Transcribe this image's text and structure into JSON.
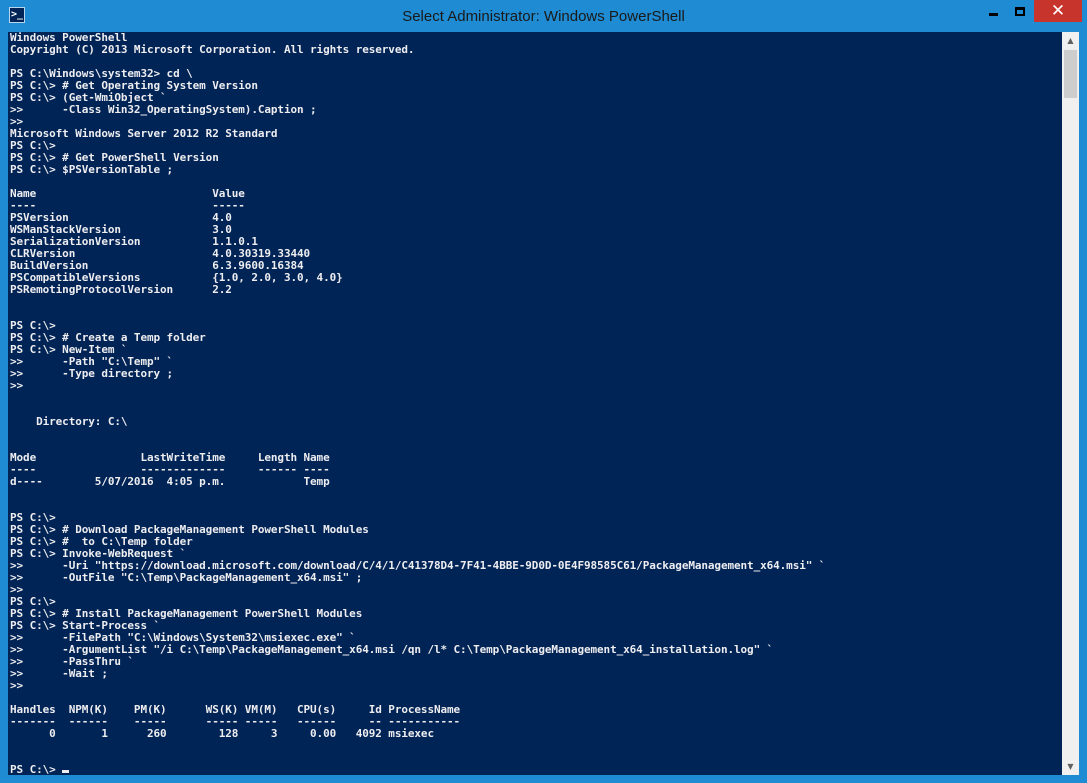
{
  "window": {
    "title": "Select Administrator: Windows PowerShell",
    "app_icon": "powershell-icon",
    "app_icon_glyph": ">_",
    "accent_color": "#1E8BD2",
    "console_background": "#012456",
    "console_foreground": "#EEEDF0",
    "close_color": "#C7342B"
  },
  "controls": {
    "close_glyph": "✕"
  },
  "scrollbar": {
    "up_glyph": "▲",
    "down_glyph": "▼"
  },
  "console": {
    "lines": [
      "Windows PowerShell",
      "Copyright (C) 2013 Microsoft Corporation. All rights reserved.",
      "",
      "PS C:\\Windows\\system32> cd \\",
      "PS C:\\> # Get Operating System Version",
      "PS C:\\> (Get-WmiObject `",
      ">>      -Class Win32_OperatingSystem).Caption ;",
      ">>",
      "Microsoft Windows Server 2012 R2 Standard",
      "PS C:\\>",
      "PS C:\\> # Get PowerShell Version",
      "PS C:\\> $PSVersionTable ;",
      "",
      "Name                           Value",
      "----                           -----",
      "PSVersion                      4.0",
      "WSManStackVersion              3.0",
      "SerializationVersion           1.1.0.1",
      "CLRVersion                     4.0.30319.33440",
      "BuildVersion                   6.3.9600.16384",
      "PSCompatibleVersions           {1.0, 2.0, 3.0, 4.0}",
      "PSRemotingProtocolVersion      2.2",
      "",
      "",
      "PS C:\\>",
      "PS C:\\> # Create a Temp folder",
      "PS C:\\> New-Item `",
      ">>      -Path \"C:\\Temp\" `",
      ">>      -Type directory ;",
      ">>",
      "",
      "",
      "    Directory: C:\\",
      "",
      "",
      "Mode                LastWriteTime     Length Name",
      "----                -------------     ------ ----",
      "d----        5/07/2016  4:05 p.m.            Temp",
      "",
      "",
      "PS C:\\>",
      "PS C:\\> # Download PackageManagement PowerShell Modules",
      "PS C:\\> #  to C:\\Temp folder",
      "PS C:\\> Invoke-WebRequest `",
      ">>      -Uri \"https://download.microsoft.com/download/C/4/1/C41378D4-7F41-4BBE-9D0D-0E4F98585C61/PackageManagement_x64.msi\" `",
      ">>      -OutFile \"C:\\Temp\\PackageManagement_x64.msi\" ;",
      ">>",
      "PS C:\\>",
      "PS C:\\> # Install PackageManagement PowerShell Modules",
      "PS C:\\> Start-Process `",
      ">>      -FilePath \"C:\\Windows\\System32\\msiexec.exe\" `",
      ">>      -ArgumentList \"/i C:\\Temp\\PackageManagement_x64.msi /qn /l* C:\\Temp\\PackageManagement_x64_installation.log\" `",
      ">>      -PassThru `",
      ">>      -Wait ;",
      ">>",
      "",
      "Handles  NPM(K)    PM(K)      WS(K) VM(M)   CPU(s)     Id ProcessName",
      "-------  ------    -----      ----- -----   ------     -- -----------",
      "      0       1      260        128     3     0.00   4092 msiexec",
      "",
      ""
    ],
    "prompt": "PS C:\\> "
  }
}
